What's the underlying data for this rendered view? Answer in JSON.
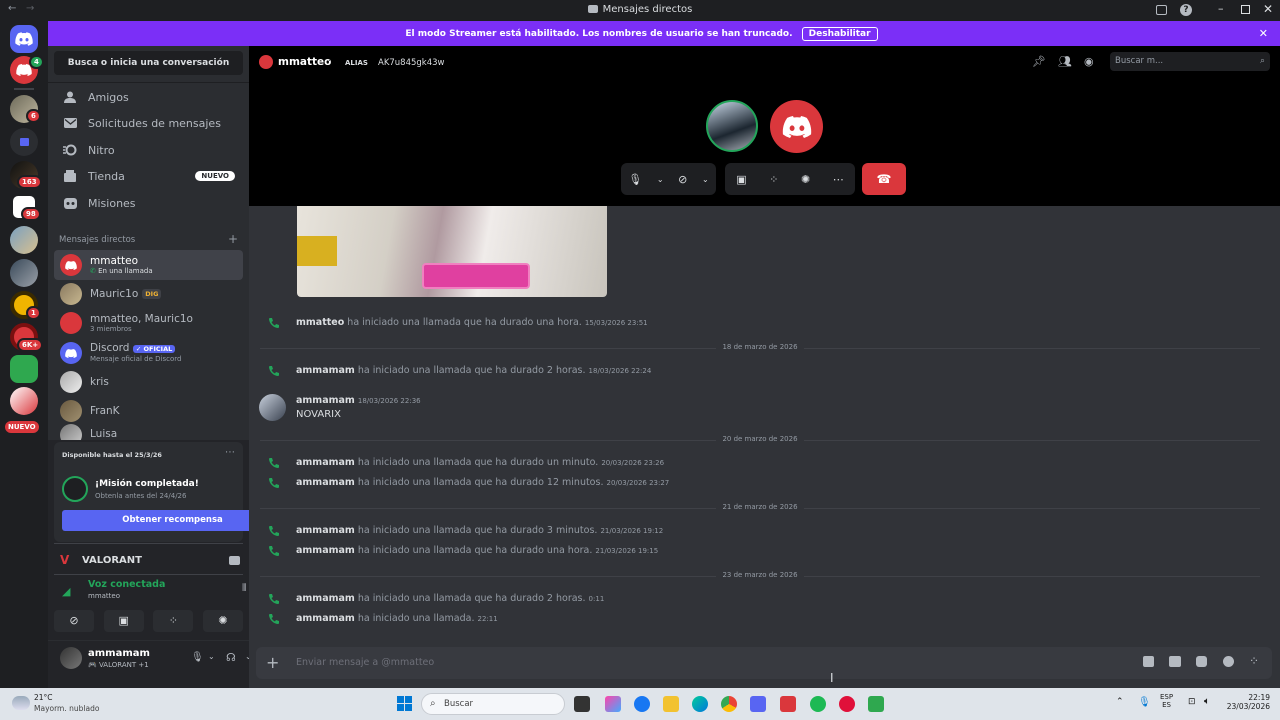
{
  "window": {
    "title": "Mensajes directos"
  },
  "banner": {
    "text": "El modo Streamer está habilitado. Los nombres de usuario se han truncado.",
    "button": "Deshabilitar"
  },
  "guilds": {
    "badges": [
      "4",
      "6",
      "163",
      "98",
      "1",
      "6K+"
    ],
    "new_label": "NUEVO"
  },
  "sidebar": {
    "search_button": "Busca o inicia una conversación",
    "nav": [
      {
        "label": "Amigos"
      },
      {
        "label": "Solicitudes de mensajes"
      },
      {
        "label": "Nitro"
      },
      {
        "label": "Tienda",
        "badge": "NUEVO"
      },
      {
        "label": "Misiones"
      }
    ],
    "dm_header": "Mensajes directos",
    "dms": [
      {
        "name": "mmatteo",
        "sub": "En una llamada"
      },
      {
        "name": "Mauric1o",
        "tag": "DIG"
      },
      {
        "name": "mmatteo, Mauric1o",
        "sub": "3 miembros"
      },
      {
        "name": "Discord",
        "tag": "OFICIAL",
        "sub": "Mensaje oficial de Discord"
      },
      {
        "name": "kris"
      },
      {
        "name": "FranK"
      },
      {
        "name": "Luisa"
      }
    ],
    "quest": {
      "available": "Disponible hasta el 25/3/26",
      "title": "¡Misión completada!",
      "subtitle": "Obtenla antes del 24/4/26",
      "button": "Obtener recompensa"
    },
    "activity": {
      "game": "VALORANT"
    },
    "voice": {
      "status": "Voz conectada",
      "channel": "mmatteo"
    },
    "user": {
      "name": "ammamam",
      "status": "VALORANT +1"
    }
  },
  "header": {
    "username": "mmatteo",
    "alias_label": "ALIAS",
    "alias_value": "AK7u845gk43w",
    "search_placeholder": "Buscar m..."
  },
  "messages": [
    {
      "type": "call",
      "user": "mmatteo",
      "text": "ha iniciado una llamada que ha durado una hora.",
      "time": "15/03/2026 23:51"
    },
    {
      "type": "date",
      "text": "18 de marzo de 2026"
    },
    {
      "type": "call",
      "user": "ammamam",
      "text": "ha iniciado una llamada que ha durado 2 horas.",
      "time": "18/03/2026 22:24"
    },
    {
      "type": "text",
      "user": "ammamam",
      "time": "18/03/2026 22:36",
      "text": "NOVARIX"
    },
    {
      "type": "date",
      "text": "20 de marzo de 2026"
    },
    {
      "type": "call",
      "user": "ammamam",
      "text": "ha iniciado una llamada que ha durado un minuto.",
      "time": "20/03/2026 23:26"
    },
    {
      "type": "call",
      "user": "ammamam",
      "text": "ha iniciado una llamada que ha durado 12 minutos.",
      "time": "20/03/2026 23:27"
    },
    {
      "type": "date",
      "text": "21 de marzo de 2026"
    },
    {
      "type": "call",
      "user": "ammamam",
      "text": "ha iniciado una llamada que ha durado 3 minutos.",
      "time": "21/03/2026 19:12"
    },
    {
      "type": "call",
      "user": "ammamam",
      "text": "ha iniciado una llamada que ha durado una hora.",
      "time": "21/03/2026 19:15"
    },
    {
      "type": "date",
      "text": "23 de marzo de 2026"
    },
    {
      "type": "call",
      "user": "ammamam",
      "text": "ha iniciado una llamada que ha durado 2 horas.",
      "time": "0:11"
    },
    {
      "type": "call",
      "user": "ammamam",
      "text": "ha iniciado una llamada.",
      "time": "22:11"
    }
  ],
  "composer": {
    "placeholder": "Enviar mensaje a @mmatteo"
  },
  "taskbar": {
    "temp": "21°C",
    "weather": "Mayorm. nublado",
    "search": "Buscar",
    "lang": "ESP",
    "region": "ES",
    "time": "22:19",
    "date": "23/03/2026"
  },
  "colors": {
    "blurple": "#5865f2",
    "banner": "#7b2ff7",
    "green": "#23a55a",
    "red": "#da373c"
  }
}
